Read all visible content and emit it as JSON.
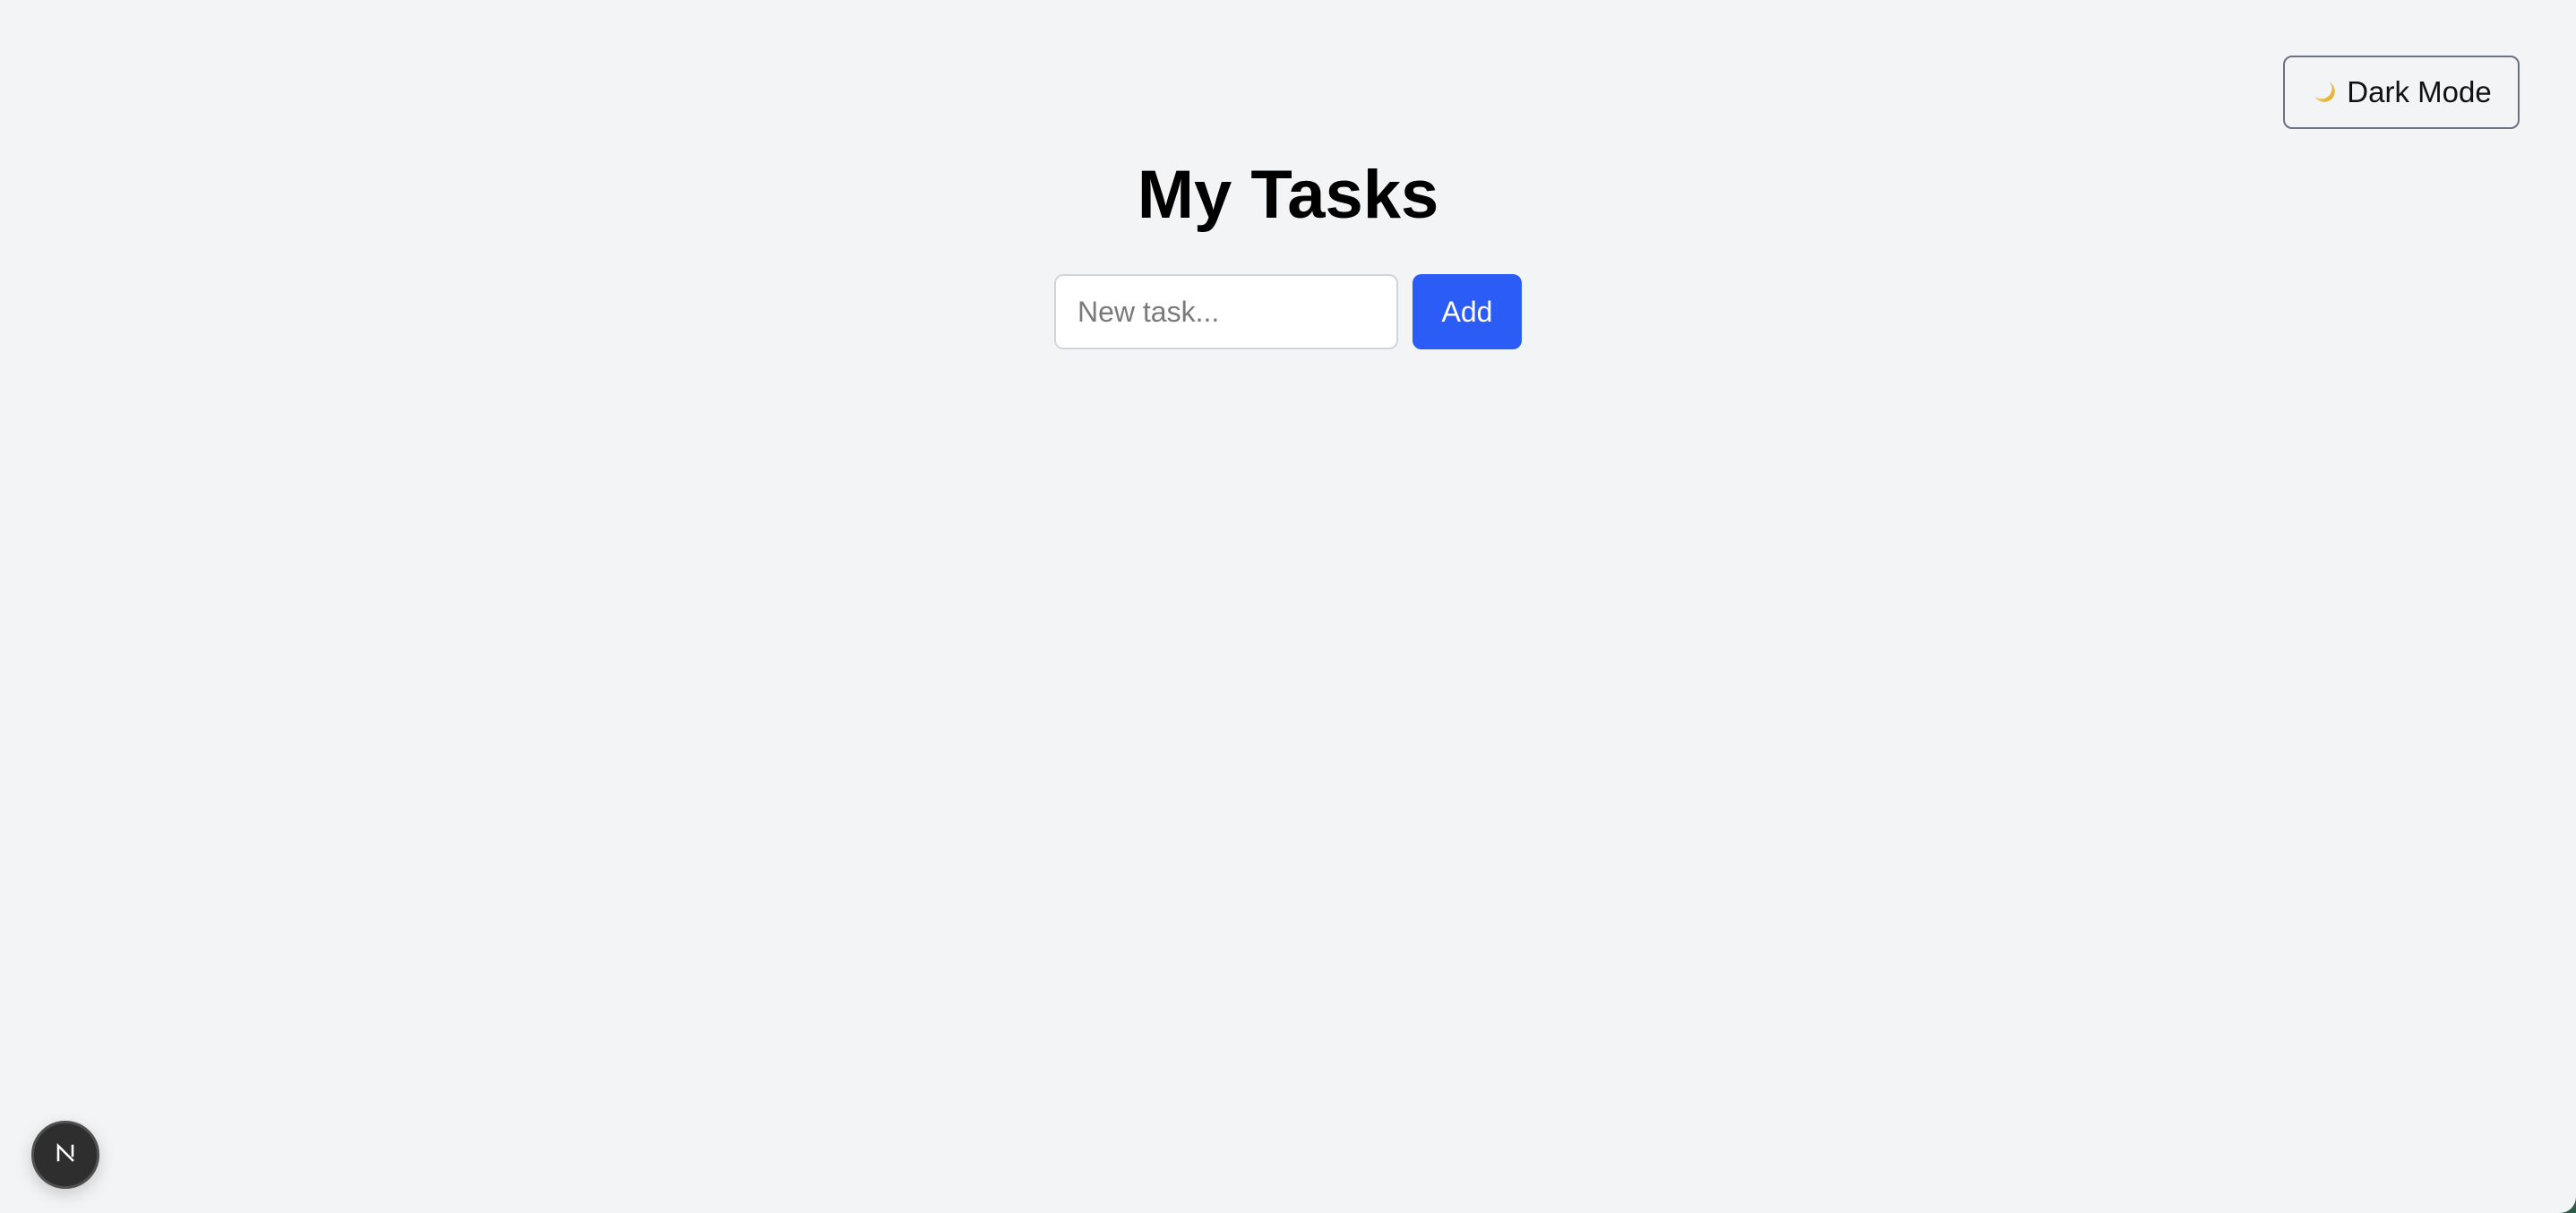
{
  "theme_toggle": {
    "label": "Dark Mode",
    "icon": "crescent-moon-icon"
  },
  "header": {
    "title": "My Tasks"
  },
  "task_form": {
    "input_value": "",
    "input_placeholder": "New task...",
    "add_label": "Add"
  },
  "dev_badge": {
    "icon": "nextjs-logo-icon",
    "letter": "N"
  },
  "colors": {
    "background": "#f3f4f6",
    "accent": "#2b5cf5",
    "toggle_border": "#6b7280",
    "input_border": "#d1d5db",
    "badge": "#2e2e2e"
  }
}
